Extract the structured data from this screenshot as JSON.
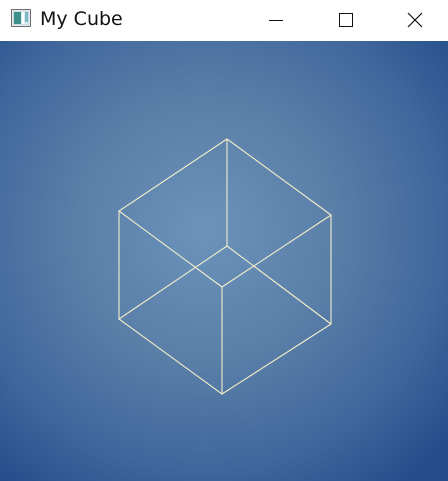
{
  "window": {
    "title": "My Cube",
    "icon": "window-app-icon"
  },
  "caption_buttons": {
    "minimize_icon": "minimize-icon",
    "maximize_icon": "maximize-icon",
    "close_icon": "close-icon"
  },
  "scene": {
    "object": "wireframe-cube",
    "line_color": "#f2ecc9",
    "background_center_color": "#6b93bb",
    "background_edge_color": "#254d8a"
  }
}
